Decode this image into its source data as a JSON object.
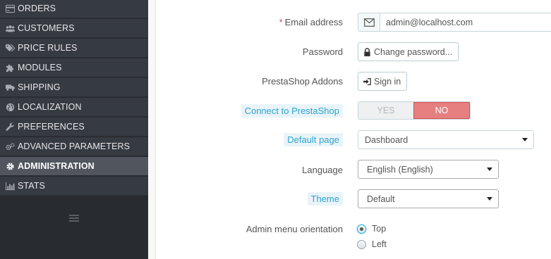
{
  "sidebar": {
    "items": [
      {
        "label": "ORDERS",
        "icon": "credit-card-icon"
      },
      {
        "label": "CUSTOMERS",
        "icon": "users-icon"
      },
      {
        "label": "PRICE RULES",
        "icon": "tags-icon"
      },
      {
        "label": "MODULES",
        "icon": "puzzle-icon"
      },
      {
        "label": "SHIPPING",
        "icon": "truck-icon"
      },
      {
        "label": "LOCALIZATION",
        "icon": "globe-icon"
      },
      {
        "label": "PREFERENCES",
        "icon": "wrench-icon"
      },
      {
        "label": "ADVANCED PARAMETERS",
        "icon": "cogs-icon"
      },
      {
        "label": "ADMINISTRATION",
        "icon": "cog-icon",
        "active": true
      },
      {
        "label": "STATS",
        "icon": "bar-chart-icon"
      }
    ],
    "collapse_icon": "menu-collapse-icon"
  },
  "form": {
    "email": {
      "required_mark": "*",
      "label": "Email address",
      "value": "admin@localhost.com",
      "icon": "envelope-icon"
    },
    "password": {
      "label": "Password",
      "button_label": "Change password...",
      "icon": "lock-icon"
    },
    "addons": {
      "label": "PrestaShop Addons",
      "button_label": "Sign in",
      "icon": "sign-in-icon"
    },
    "connect": {
      "label": "Connect to PrestaShop",
      "yes_label": "YES",
      "no_label": "NO",
      "selected": "NO"
    },
    "default_page": {
      "label": "Default page",
      "value": "Dashboard"
    },
    "language": {
      "label": "Language",
      "value": "English (English)"
    },
    "theme": {
      "label": "Theme",
      "value": "Default"
    },
    "menu_orientation": {
      "label": "Admin menu orientation",
      "options": [
        "Top",
        "Left"
      ],
      "selected": "Top"
    }
  },
  "colors": {
    "sidebar_bg": "#363a41",
    "sidebar_active": "#50555e",
    "accent": "#25b9d7",
    "hint_text": "#2ea4cf",
    "danger_switch": "#e57f80",
    "required": "#e0434b"
  }
}
